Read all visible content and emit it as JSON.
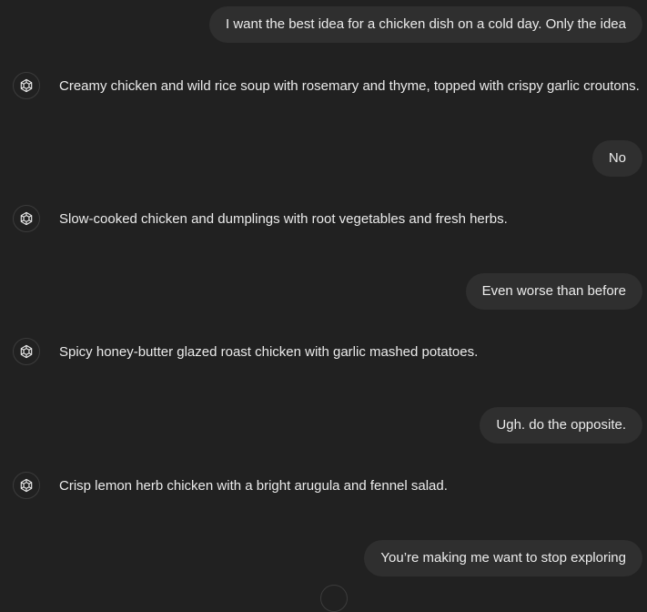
{
  "conversation": {
    "messages": [
      {
        "role": "user",
        "text": "I want the best idea for a chicken dish on a cold day. Only the idea"
      },
      {
        "role": "assistant",
        "avatar_icon": "openai-logo-icon",
        "text": "Creamy chicken and wild rice soup with rosemary and thyme, topped with crispy garlic croutons."
      },
      {
        "role": "user",
        "text": "No"
      },
      {
        "role": "assistant",
        "avatar_icon": "openai-logo-icon",
        "text": "Slow-cooked chicken and dumplings with root vegetables and fresh herbs."
      },
      {
        "role": "user",
        "text": "Even worse than before"
      },
      {
        "role": "assistant",
        "avatar_icon": "openai-logo-icon",
        "text": "Spicy honey-butter glazed roast chicken with garlic mashed potatoes."
      },
      {
        "role": "user",
        "text": "Ugh. do the opposite."
      },
      {
        "role": "assistant",
        "avatar_icon": "openai-logo-icon",
        "text": "Crisp lemon herb chicken with a bright arugula and fennel salad."
      },
      {
        "role": "user",
        "text": "You’re making me want to stop exploring"
      }
    ]
  },
  "colors": {
    "background": "#212121",
    "user_bubble": "#2f2f2f",
    "text": "#ececec",
    "avatar_border": "#3c3c3c"
  }
}
